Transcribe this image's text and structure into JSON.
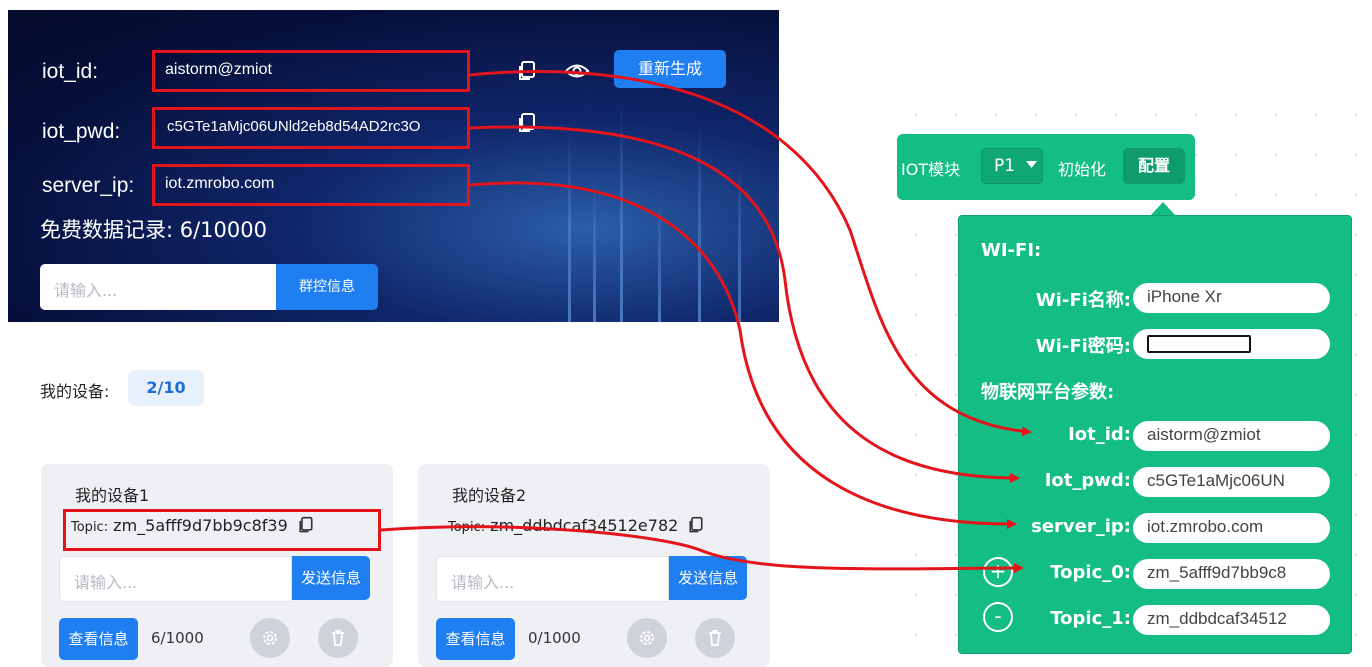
{
  "credentials": {
    "iot_id_label": "iot_id:",
    "iot_id_value": "aistorm@zmiot",
    "iot_pwd_label": "iot_pwd:",
    "iot_pwd_value": "c5GTe1aMjc06UNld2eb8d54AD2rc3O",
    "server_ip_label": "server_ip:",
    "server_ip_value": "iot.zmrobo.com",
    "regenerate_label": "重新生成",
    "free_records": "免费数据记录: 6/10000",
    "group_input_placeholder": "请输入...",
    "group_button_label": "群控信息"
  },
  "devices": {
    "label": "我的设备:",
    "count": "2/10",
    "cards": [
      {
        "name": "我的设备1",
        "topic_key": "Topic:",
        "topic_value": "zm_5afff9d7bb9c8f39",
        "input_placeholder": "请输入...",
        "send_label": "发送信息",
        "view_label": "查看信息",
        "usage": "6/1000"
      },
      {
        "name": "我的设备2",
        "topic_key": "Topic:",
        "topic_value": "zm_ddbdcaf34512e782",
        "input_placeholder": "请输入...",
        "send_label": "发送信息",
        "view_label": "查看信息",
        "usage": "0/1000"
      }
    ]
  },
  "block": {
    "module_label": "IOT模块",
    "port": "P1",
    "init_label": "初始化",
    "config_label": "配置",
    "wifi_section": "WI-FI:",
    "wifi_name_label": "Wi-Fi名称:",
    "wifi_name_value": "iPhone Xr",
    "wifi_pwd_label": "Wi-Fi密码:",
    "iot_section": "物联网平台参数:",
    "iot_id_label": "Iot_id:",
    "iot_id_value": "aistorm@zmiot",
    "iot_pwd_label": "Iot_pwd:",
    "iot_pwd_value": "c5GTe1aMjc06UN",
    "server_ip_label": "server_ip:",
    "server_ip_value": "iot.zmrobo.com",
    "topic0_label": "Topic_0:",
    "topic0_value": "zm_5afff9d7bb9c8",
    "topic1_label": "Topic_1:",
    "topic1_value": "zm_ddbdcaf34512",
    "add_symbol": "+",
    "remove_symbol": "-"
  },
  "colors": {
    "highlight_red": "#e3141b",
    "brand_blue": "#1f7ff0",
    "block_green": "#14bd84"
  }
}
